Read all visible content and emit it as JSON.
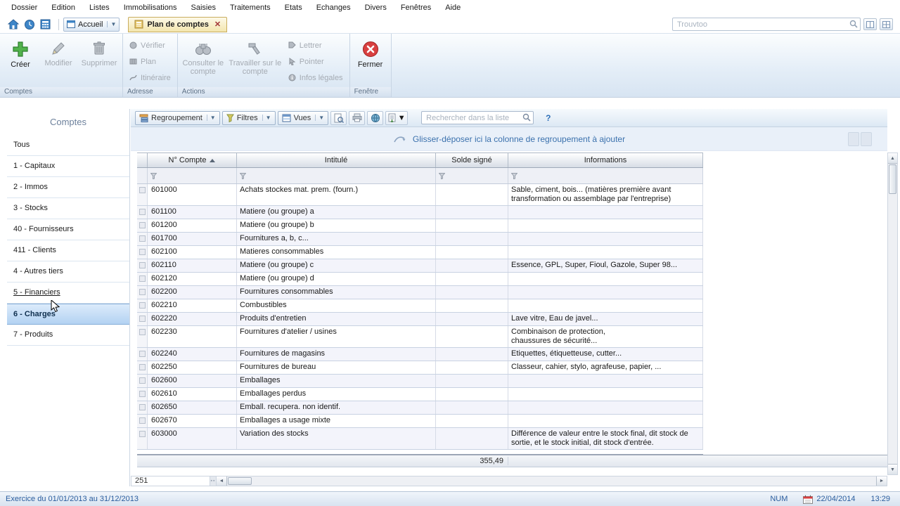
{
  "menubar": {
    "items": [
      "Dossier",
      "Edition",
      "Listes",
      "Immobilisations",
      "Saisies",
      "Traitements",
      "Etats",
      "Echanges",
      "Divers",
      "Fenêtres",
      "Aide"
    ]
  },
  "tabbar": {
    "home_tab": "Accueil",
    "active_tab": "Plan de comptes",
    "search_placeholder": "Trouvtoo"
  },
  "ribbon": {
    "groups": [
      {
        "label": "Comptes"
      },
      {
        "label": "Adresse"
      },
      {
        "label": "Actions"
      },
      {
        "label": "Fenêtre"
      }
    ],
    "buttons": {
      "creer": "Créer",
      "modifier": "Modifier",
      "supprimer": "Supprimer",
      "verifier": "Vérifier",
      "plan": "Plan",
      "itineraire": "Itinéraire",
      "consulter": "Consulter le compte",
      "travailler": "Travailler sur le compte",
      "lettrer": "Lettrer",
      "pointer": "Pointer",
      "infos": "Infos légales",
      "fermer": "Fermer"
    }
  },
  "sidebar": {
    "title": "Comptes",
    "items": [
      {
        "label": "Tous"
      },
      {
        "label": "1 - Capitaux"
      },
      {
        "label": "2 - Immos"
      },
      {
        "label": "3 - Stocks"
      },
      {
        "label": "40 - Fournisseurs"
      },
      {
        "label": "411 - Clients"
      },
      {
        "label": "4 - Autres tiers"
      },
      {
        "label": "5 - Financiers"
      },
      {
        "label": "6 - Charges"
      },
      {
        "label": "7 - Produits"
      }
    ]
  },
  "list_toolbar": {
    "regroupement": "Regroupement",
    "filtres": "Filtres",
    "vues": "Vues",
    "search_placeholder": "Rechercher dans la liste",
    "help": "?"
  },
  "group_bar": {
    "hint": "Glisser-déposer ici la colonne de regroupement à ajouter"
  },
  "table": {
    "columns": [
      "N° Compte",
      "Intitulé",
      "Solde signé",
      "Informations"
    ],
    "rows": [
      {
        "compte": "601000",
        "intitule": "Achats stockes mat. prem. (fourn.)",
        "solde": "",
        "info": "Sable, ciment, bois... (matières première avant transformation ou assemblage par l'entreprise)"
      },
      {
        "compte": "601100",
        "intitule": "Matiere (ou groupe) a",
        "solde": "",
        "info": ""
      },
      {
        "compte": "601200",
        "intitule": "Matiere (ou groupe) b",
        "solde": "",
        "info": ""
      },
      {
        "compte": "601700",
        "intitule": "Fournitures a, b, c...",
        "solde": "",
        "info": ""
      },
      {
        "compte": "602100",
        "intitule": "Matieres consommables",
        "solde": "",
        "info": ""
      },
      {
        "compte": "602110",
        "intitule": "Matiere (ou groupe) c",
        "solde": "",
        "info": "Essence, GPL, Super, Fioul, Gazole, Super 98..."
      },
      {
        "compte": "602120",
        "intitule": "Matiere (ou groupe) d",
        "solde": "",
        "info": ""
      },
      {
        "compte": "602200",
        "intitule": "Fournitures consommables",
        "solde": "",
        "info": ""
      },
      {
        "compte": "602210",
        "intitule": "Combustibles",
        "solde": "",
        "info": ""
      },
      {
        "compte": "602220",
        "intitule": "Produits d'entretien",
        "solde": "",
        "info": "Lave vitre, Eau de javel..."
      },
      {
        "compte": "602230",
        "intitule": "Fournitures d'atelier / usines",
        "solde": "",
        "info": "Combinaison de protection,\nchaussures de sécurité..."
      },
      {
        "compte": "602240",
        "intitule": "Fournitures de magasins",
        "solde": "",
        "info": "Etiquettes, étiquetteuse, cutter..."
      },
      {
        "compte": "602250",
        "intitule": "Fournitures de bureau",
        "solde": "",
        "info": "Classeur, cahier, stylo, agrafeuse, papier, ..."
      },
      {
        "compte": "602600",
        "intitule": "Emballages",
        "solde": "",
        "info": ""
      },
      {
        "compte": "602610",
        "intitule": "Emballages perdus",
        "solde": "",
        "info": ""
      },
      {
        "compte": "602650",
        "intitule": "Emball. recupera. non identif.",
        "solde": "",
        "info": ""
      },
      {
        "compte": "602670",
        "intitule": "Emballages a usage mixte",
        "solde": "",
        "info": ""
      },
      {
        "compte": "603000",
        "intitule": "Variation des stocks",
        "solde": "",
        "info": "Différence de valeur entre le stock final, dit stock de sortie, et le stock initial, dit stock d'entrée."
      }
    ],
    "footer": {
      "solde_total": "355,49"
    }
  },
  "bottom": {
    "record_count": "251"
  },
  "statusbar": {
    "exercice": "Exercice du 01/01/2013 au 31/12/2013",
    "num": "NUM",
    "date": "22/04/2014",
    "time": "13:29"
  }
}
